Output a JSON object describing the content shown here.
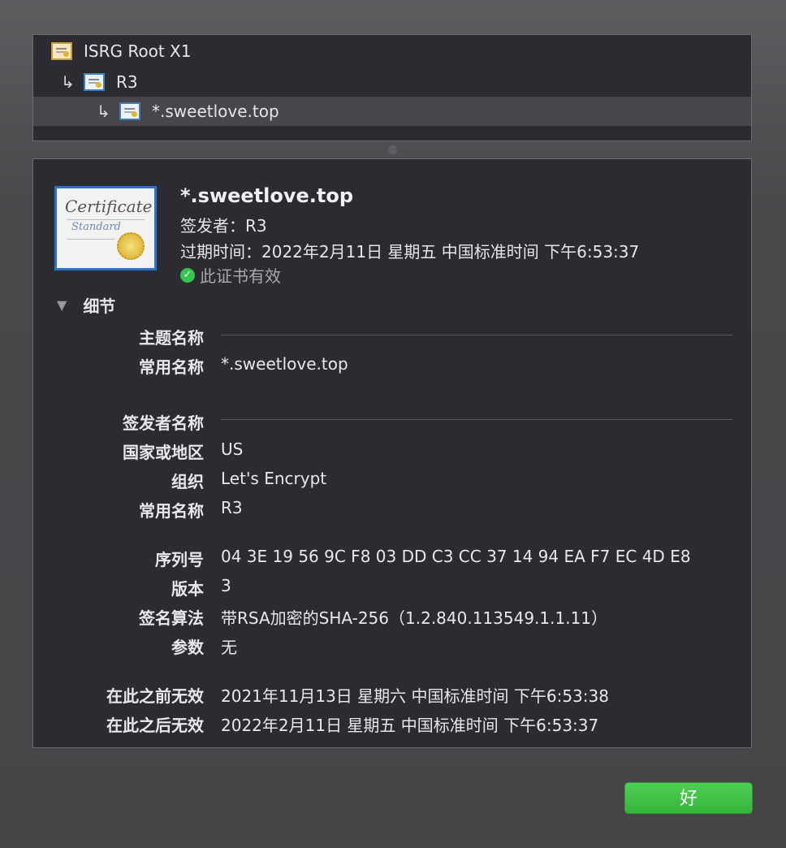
{
  "chain": {
    "items": [
      {
        "label": "ISRG Root X1"
      },
      {
        "label": "R3"
      },
      {
        "label": "*.sweetlove.top"
      }
    ],
    "arrow": "↳"
  },
  "certificate": {
    "badge_title": "Certificate",
    "badge_sub": "Standard",
    "name": "*.sweetlove.top",
    "issuer_line": "签发者：R3",
    "expiry_line": "过期时间：2022年2月11日 星期五 中国标准时间 下午6:53:37",
    "valid_text": "此证书有效",
    "valid_color": "#35c44f"
  },
  "details": {
    "toggle_label": "细节",
    "subject_header": "主题名称",
    "subject_cn_label": "常用名称",
    "subject_cn_value": "*.sweetlove.top",
    "issuer_header": "签发者名称",
    "country_label": "国家或地区",
    "country_value": "US",
    "org_label": "组织",
    "org_value": "Let's Encrypt",
    "issuer_cn_label": "常用名称",
    "issuer_cn_value": "R3",
    "serial_label": "序列号",
    "serial_value": "04 3E 19 56 9C F8 03 DD C3 CC 37 14 94 EA F7 EC 4D E8",
    "version_label": "版本",
    "version_value": "3",
    "sigalg_label": "签名算法",
    "sigalg_value": "带RSA加密的SHA-256（1.2.840.113549.1.1.11）",
    "params_label": "参数",
    "params_value": "无",
    "not_before_label": "在此之前无效",
    "not_before_value": "2021年11月13日 星期六 中国标准时间 下午6:53:38",
    "not_after_label": "在此之后无效",
    "not_after_value": "2022年2月11日 星期五 中国标准时间 下午6:53:37"
  },
  "buttons": {
    "ok_label": "好",
    "ok_color": "#3fbf45"
  }
}
